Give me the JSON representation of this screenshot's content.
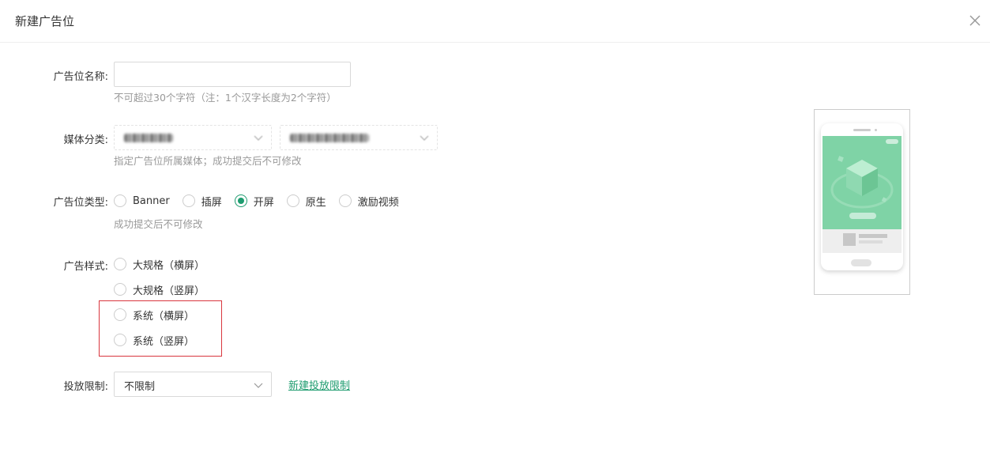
{
  "dialog": {
    "title": "新建广告位",
    "close_icon": "close-icon"
  },
  "form": {
    "name": {
      "label": "广告位名称:",
      "value": "",
      "placeholder": "",
      "hint": "不可超过30个字符（注：1个汉字长度为2个字符）"
    },
    "media": {
      "label": "媒体分类:",
      "hint": "指定广告位所属媒体；成功提交后不可修改"
    },
    "type": {
      "label": "广告位类型:",
      "options": [
        {
          "label": "Banner",
          "checked": false
        },
        {
          "label": "插屏",
          "checked": false
        },
        {
          "label": "开屏",
          "checked": true
        },
        {
          "label": "原生",
          "checked": false
        },
        {
          "label": "激励视频",
          "checked": false
        }
      ],
      "hint": "成功提交后不可修改"
    },
    "style": {
      "label": "广告样式:",
      "options": [
        {
          "label": "大规格（横屏）",
          "checked": false
        },
        {
          "label": "大规格（竖屏）",
          "checked": false
        },
        {
          "label": "系统（横屏）",
          "checked": false
        },
        {
          "label": "系统（竖屏）",
          "checked": false
        }
      ]
    },
    "limit": {
      "label": "投放限制:",
      "selected": "不限制",
      "new_link": "新建投放限制"
    }
  },
  "colors": {
    "accent": "#1e9c6f",
    "highlight_border": "#d9363e",
    "preview_screen": "#7fd3a6"
  }
}
